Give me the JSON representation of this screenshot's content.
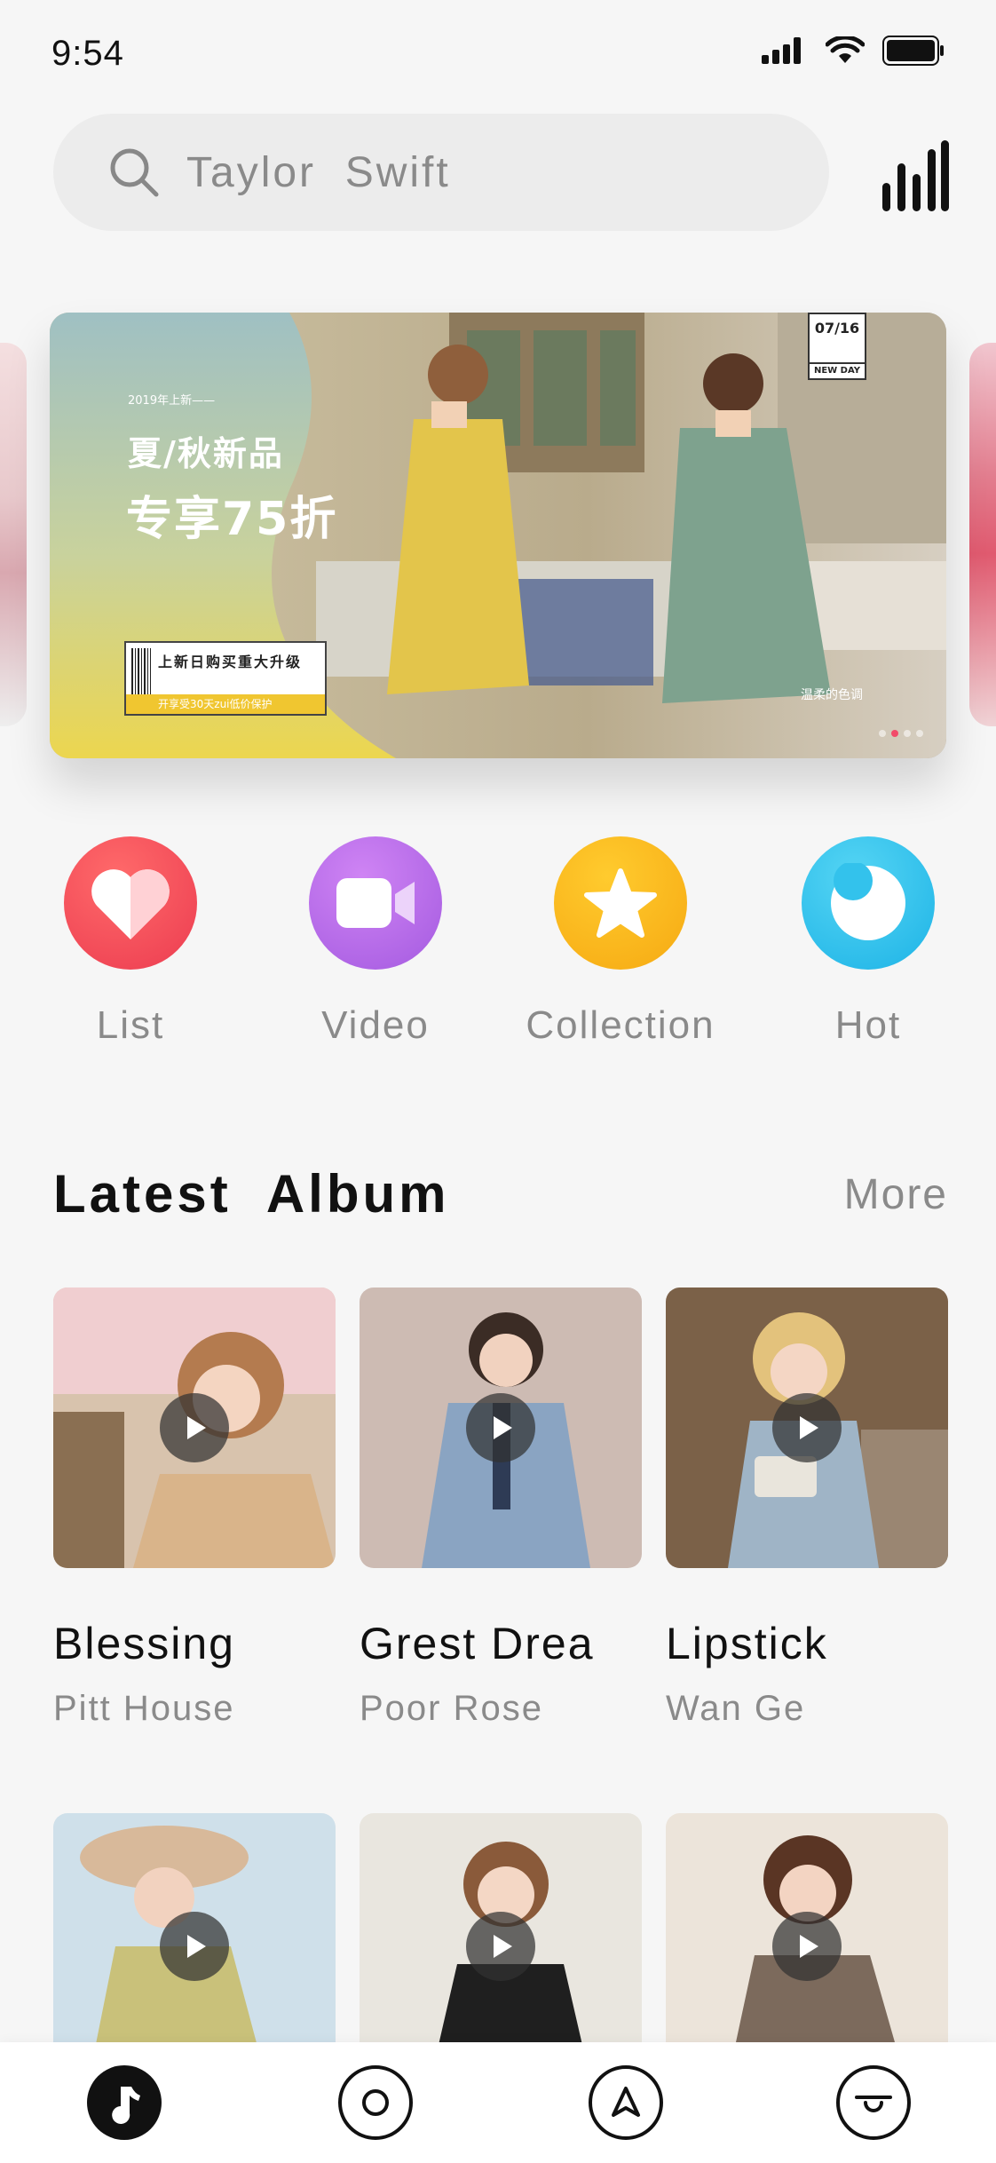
{
  "status_bar": {
    "time": "9:54"
  },
  "search": {
    "placeholder": "Taylor  Swift"
  },
  "banner": {
    "subtitle": "2019年上新——",
    "headline1": "夏/秋新品",
    "headline2": "专享75折",
    "coupon_text": "上新日购买重大升级",
    "coupon_strip": "开享受30天zui低价保护",
    "date_top": "07/16",
    "date_bottom": "NEW DAY",
    "caption": "温柔的色调",
    "dots": 4,
    "active_dot": 1
  },
  "categories": [
    {
      "label": "List",
      "icon": "heart-icon",
      "color": "#f04a55"
    },
    {
      "label": "Video",
      "icon": "video-camera-icon",
      "color": "#b66be6"
    },
    {
      "label": "Collection",
      "icon": "star-icon",
      "color": "#f6b41c"
    },
    {
      "label": "Hot",
      "icon": "moon-icon",
      "color": "#33c2ec"
    }
  ],
  "latest_album": {
    "title": "Latest  Album",
    "more_label": "More",
    "albums": [
      {
        "title": "Blessing",
        "artist": "Pitt House"
      },
      {
        "title": "Grest Drea",
        "artist": "Poor Rose"
      },
      {
        "title": "Lipstick",
        "artist": "Wan Ge"
      }
    ]
  },
  "tab_bar": {
    "tabs": [
      {
        "icon": "music-note-icon",
        "active": true
      },
      {
        "icon": "circle-icon",
        "active": false
      },
      {
        "icon": "navigation-arrow-icon",
        "active": false
      },
      {
        "icon": "smile-icon",
        "active": false
      }
    ]
  },
  "colors": {
    "background": "#f6f6f6",
    "accent_pink": "#f24b6a",
    "text_primary": "#111111",
    "text_secondary": "#8a8a8a"
  }
}
